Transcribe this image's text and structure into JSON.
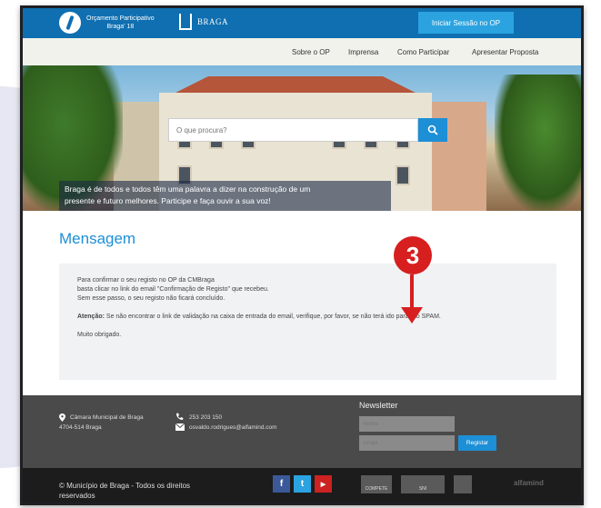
{
  "header": {
    "logo_line1": "Orçamento Participativo",
    "logo_line2": "Braga' 18",
    "braga_logo": "BRAGA",
    "login_label": "Iniciar Sessão no OP"
  },
  "nav": {
    "items": [
      {
        "label": "Sobre o OP"
      },
      {
        "label": "Imprensa"
      },
      {
        "label": "Como Participar"
      },
      {
        "label": "Apresentar Proposta"
      }
    ]
  },
  "hero": {
    "search_placeholder": "O que procura?",
    "caption_line1": "Braga é de todos e todos têm uma palavra a dizer na construção de um",
    "caption_line2": "presente e futuro melhores. Participe e faça ouvir a sua voz!"
  },
  "message": {
    "title": "Mensagem",
    "line1": "Para confirmar o seu registo no OP da CMBraga",
    "line2": "basta clicar no link do email \"Confirmação de Registo\" que recebeu.",
    "line3": "Sem esse passo, o seu registo não ficará concluído.",
    "warning_label": "Atenção:",
    "warning_text": " Se não encontrar o link de validação na caixa de entrada do email, verifique, por favor, se não terá ido parar ao SPAM.",
    "thanks": "Muito obrigado."
  },
  "annotation": {
    "step_number": "3",
    "color": "#d71f1f"
  },
  "footer": {
    "address_line1": "Câmara Municipal de Braga",
    "address_line2": "4704-514 Braga",
    "phone": "253 203 150",
    "email": "osvaldo.rodrigues@alfamind.com",
    "newsletter_title": "Newsletter",
    "name_placeholder": "Nome",
    "email_placeholder": "Email",
    "register_label": "Registar"
  },
  "bottom": {
    "copyright_line1": "© Município de Braga - Todos os direitos",
    "copyright_line2": "reservados",
    "social": [
      {
        "icon": "facebook-icon",
        "glyph": "f",
        "color": "#3b5998"
      },
      {
        "icon": "twitter-icon",
        "glyph": "t",
        "color": "#2aa3e0"
      },
      {
        "icon": "youtube-icon",
        "glyph": "▶",
        "color": "#cc2222"
      }
    ],
    "partners": [
      {
        "label": "COMPETE"
      },
      {
        "label": "SNI"
      },
      {
        "label": ""
      }
    ],
    "brand": "alfamind"
  },
  "colors": {
    "brand_blue": "#0f6fb0",
    "accent_blue": "#1d8fd6",
    "title_blue": "#1d8fd6"
  }
}
